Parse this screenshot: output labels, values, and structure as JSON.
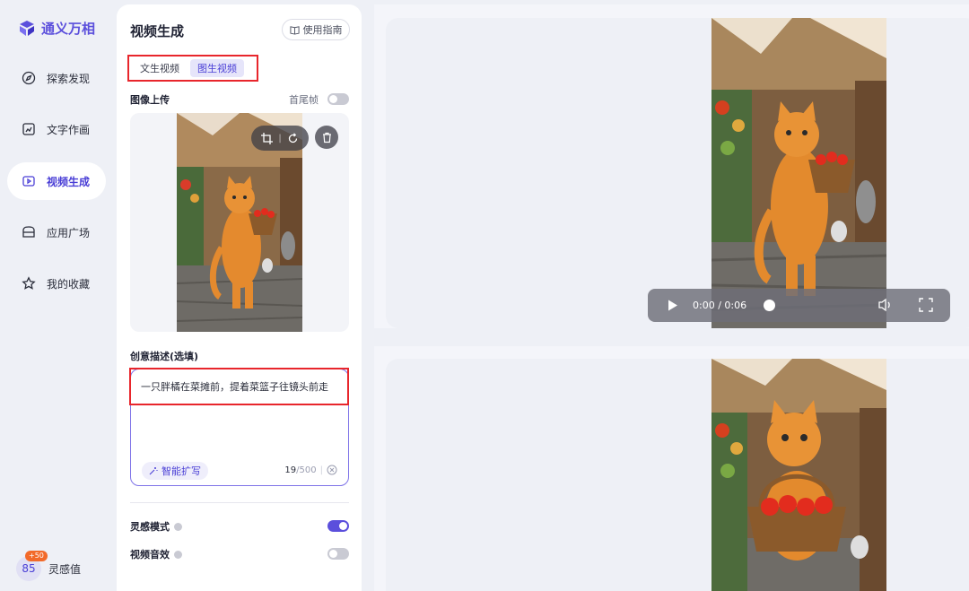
{
  "app": {
    "name": "通义万相"
  },
  "nav": {
    "items": [
      {
        "label": "探索发现",
        "icon": "compass-icon"
      },
      {
        "label": "文字作画",
        "icon": "image-edit-icon"
      },
      {
        "label": "视频生成",
        "icon": "video-play-icon",
        "active": true
      },
      {
        "label": "应用广场",
        "icon": "store-icon"
      },
      {
        "label": "我的收藏",
        "icon": "star-icon"
      }
    ],
    "points": {
      "value": "85",
      "badge": "+50",
      "label": "灵感值"
    }
  },
  "panel": {
    "title": "视频生成",
    "guide_label": "使用指南",
    "tabs": [
      {
        "label": "文生视频",
        "active": false
      },
      {
        "label": "图生视频",
        "active": true
      }
    ],
    "upload": {
      "label": "图像上传",
      "first_last_label": "首尾帧",
      "first_last_on": false
    },
    "prompt": {
      "label": "创意描述(选填)",
      "text": "一只胖橘在菜摊前，提着菜篮子往镜头前走",
      "smart_label": "智能扩写",
      "count": "19",
      "max": "/500"
    },
    "options": [
      {
        "label": "灵感模式",
        "on": true
      },
      {
        "label": "视频音效",
        "on": false
      }
    ]
  },
  "player": {
    "time_current": "0:00",
    "time_total": "/ 0:06",
    "progress": 0.0
  },
  "colors": {
    "accent": "#5b4fdc",
    "highlight_box": "#e8262c",
    "badge": "#f26a2a"
  }
}
